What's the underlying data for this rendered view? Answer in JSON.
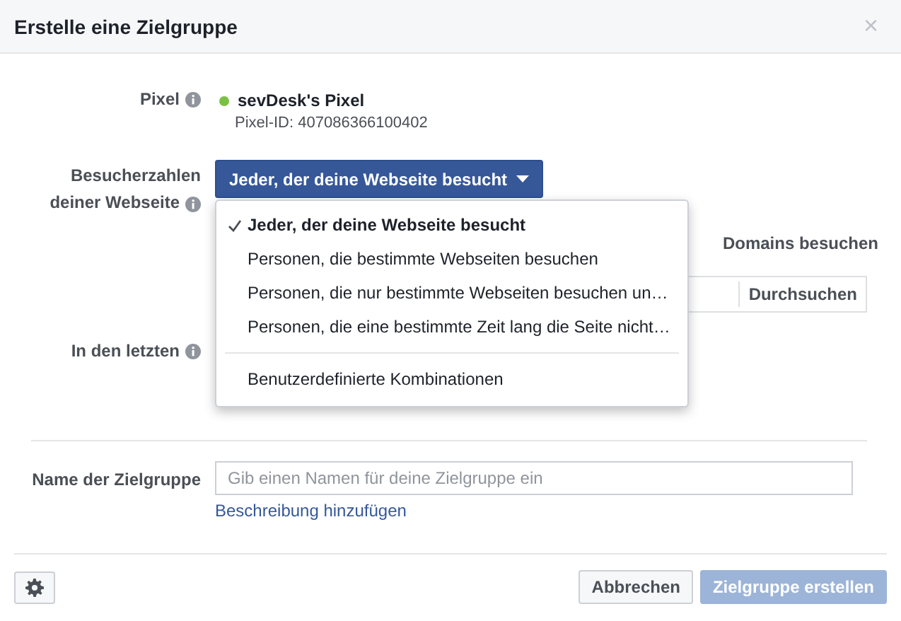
{
  "window": {
    "title": "Erstelle eine Zielgruppe",
    "close": "×"
  },
  "pixel": {
    "label": "Pixel",
    "name": "sevDesk's Pixel",
    "id": "Pixel-ID: 407086366100402",
    "color": "#7ac143"
  },
  "visitors": {
    "label_lines": [
      "Besucherzahlen",
      "deiner Webseite"
    ],
    "button": "Jeder, der deine Webseite besucht",
    "partial_text": "Domains besuchen",
    "browse_button": "Durchsuchen"
  },
  "dropdown": {
    "items": [
      {
        "kind": "option",
        "label": "Jeder, der deine Webseite besucht",
        "selected": true
      },
      {
        "kind": "option",
        "label": "Personen, die bestimmte Webseiten besuchen",
        "selected": false
      },
      {
        "kind": "option",
        "label": "Personen, die nur bestimmte Webseiten besuchen un…",
        "selected": false
      },
      {
        "kind": "option",
        "label": "Personen, die eine bestimmte Zeit lang die Seite nicht…",
        "selected": false
      },
      {
        "kind": "separator"
      },
      {
        "kind": "option",
        "label": "Benutzerdefinierte Kombinationen",
        "selected": false
      }
    ]
  },
  "last_days": {
    "label": "In den letzten"
  },
  "audience_name": {
    "label": "Name der Zielgruppe",
    "placeholder": "Gib einen Namen für deine Zielgruppe ein",
    "link": "Beschreibung hinzufügen"
  },
  "footer": {
    "buttons": [
      {
        "label": "Abbrechen",
        "kind": "secondary"
      },
      {
        "label": "Zielgruppe erstellen",
        "kind": "primary",
        "disabled": true
      }
    ]
  }
}
